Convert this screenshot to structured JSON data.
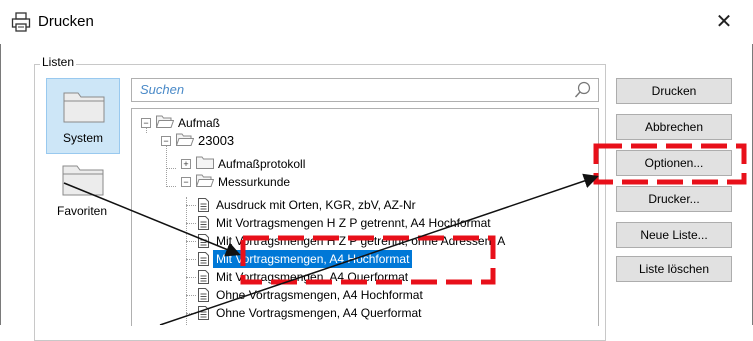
{
  "window": {
    "title": "Drucken"
  },
  "group": {
    "label": "Listen"
  },
  "categories": [
    {
      "label": "System",
      "selected": true
    },
    {
      "label": "Favoriten",
      "selected": false
    }
  ],
  "search": {
    "placeholder": "Suchen"
  },
  "tree": {
    "root": "Aufmaß",
    "project": "23003",
    "folders": [
      "Aufmaßprotokoll",
      "Messurkunde"
    ],
    "items": [
      "Ausdruck mit Orten, KGR, zbV, AZ-Nr",
      "Mit Vortragsmengen H Z P getrennt,  A4 Hochformat",
      "Mit Vortragsmengen H Z P getrennt, ohne Adressen, A",
      "Mit Vortragsmengen, A4 Hochformat",
      "Mit Vortragsmengen, A4 Querformat",
      "Ohne Vortragsmengen, A4 Hochformat",
      "Ohne Vortragsmengen, A4 Querformat"
    ],
    "selected_index": 3
  },
  "buttons": {
    "print": "Drucken",
    "cancel": "Abbrechen",
    "options": "Optionen...",
    "printer": "Drucker...",
    "new_list": "Neue Liste...",
    "delete_list": "Liste löschen"
  },
  "colors": {
    "selection": "#0078d7",
    "annotation": "#e8101a",
    "accent_text": "#4a8ac8"
  }
}
